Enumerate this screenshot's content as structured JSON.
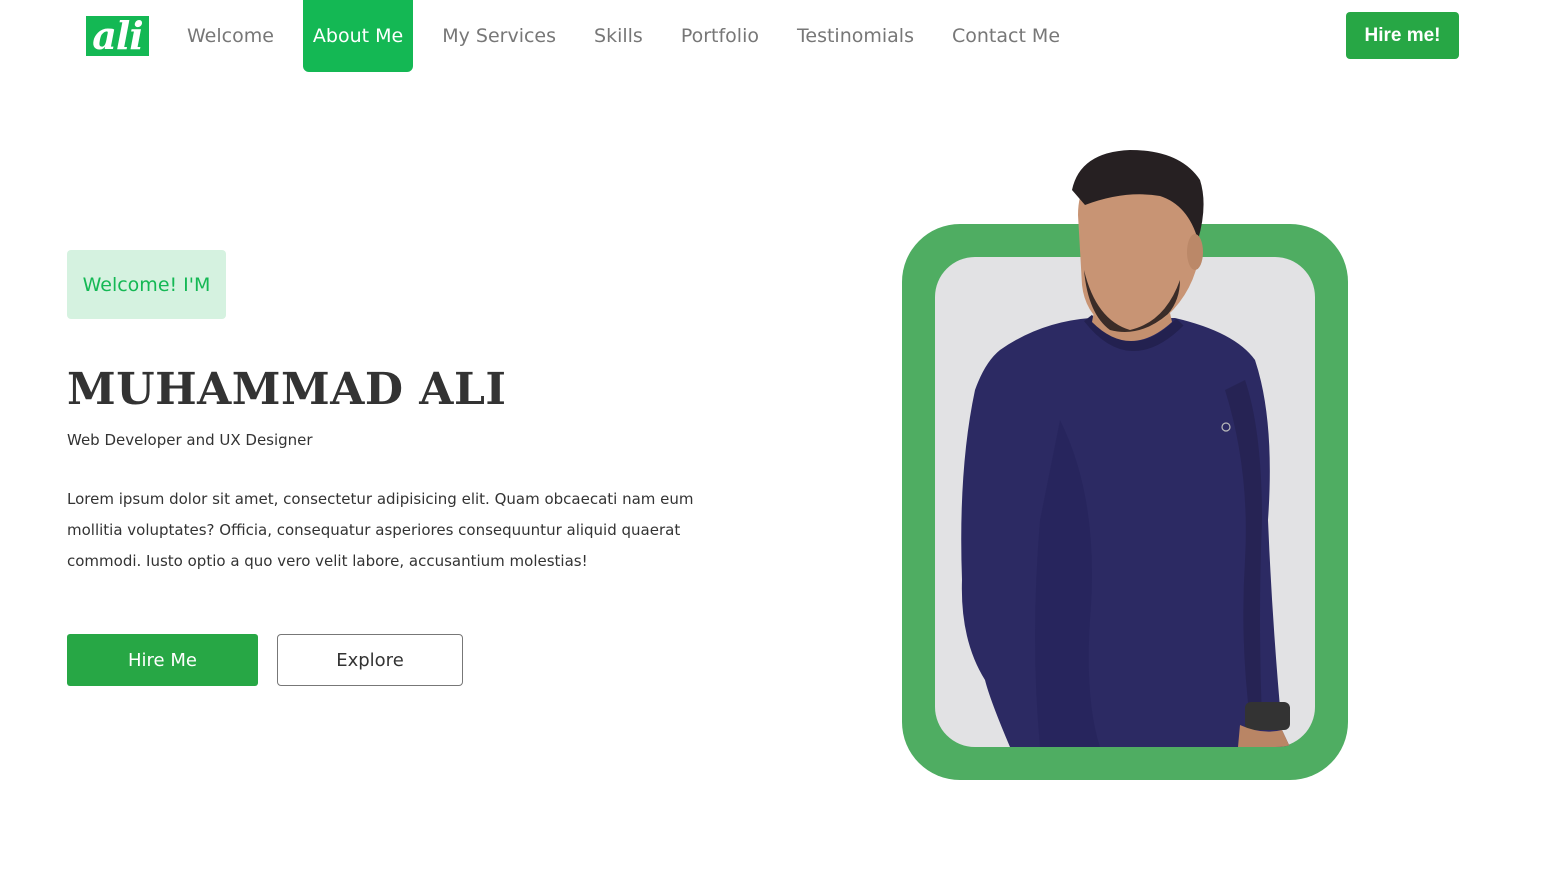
{
  "brand": {
    "logo_text": "ali",
    "color": "#14b854"
  },
  "nav": {
    "items": [
      {
        "label": "Welcome",
        "active": false
      },
      {
        "label": "About Me",
        "active": true
      },
      {
        "label": "My Services",
        "active": false
      },
      {
        "label": "Skills",
        "active": false
      },
      {
        "label": "Portfolio",
        "active": false
      },
      {
        "label": "Testinomials",
        "active": false
      },
      {
        "label": "Contact Me",
        "active": false
      }
    ],
    "hire_button": "Hire me!"
  },
  "hero": {
    "badge": "Welcome! I'M",
    "name": "MUHAMMAD ALI",
    "role": "Web Developer and UX Designer",
    "description": "Lorem ipsum dolor sit amet, consectetur adipisicing elit. Quam obcaecati nam eum mollitia voluptates? Officia, consequatur asperiores consequuntur aliquid quaerat commodi. Iusto optio a quo vero velit labore, accusantium molestias!",
    "primary_button": "Hire Me",
    "secondary_button": "Explore"
  },
  "portrait": {
    "icon": "person-portrait",
    "frame_color": "#4fad62"
  }
}
